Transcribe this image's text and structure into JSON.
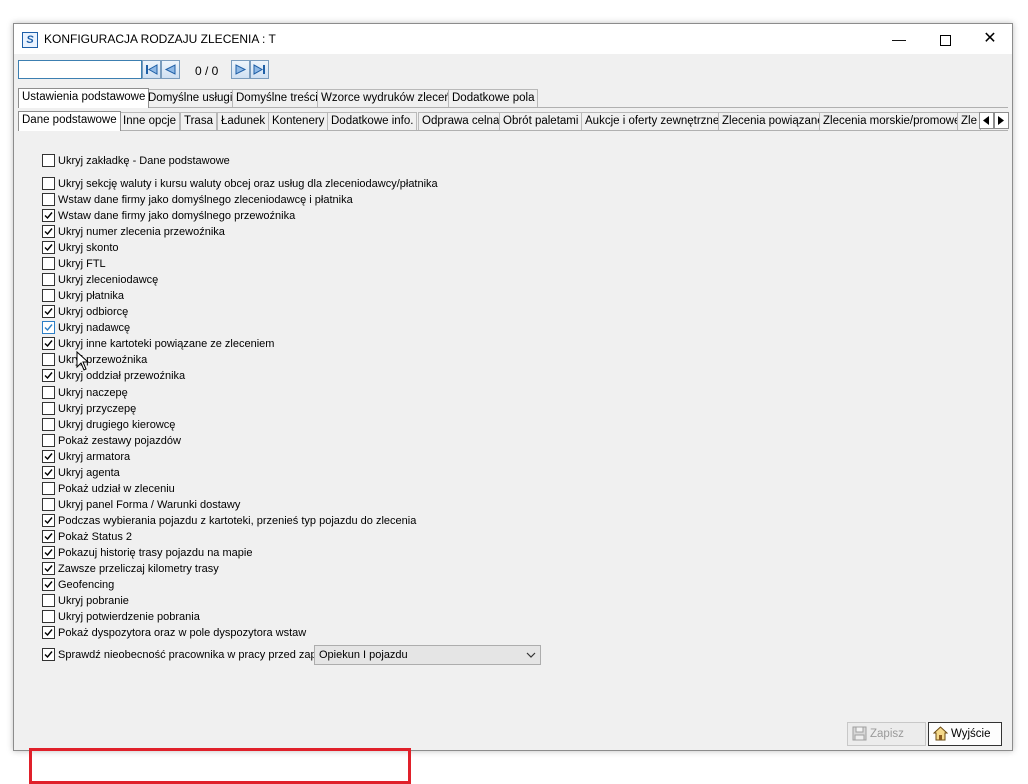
{
  "window": {
    "title": "KONFIGURACJA RODZAJU ZLECENIA : T",
    "app_icon": "S",
    "minimize": "—",
    "close": "✕"
  },
  "toolbar": {
    "search_value": "",
    "counter": "0 / 0"
  },
  "tabs_main": [
    {
      "label": "Ustawienia podstawowe",
      "active": true
    },
    {
      "label": "Domyślne usługi",
      "active": false
    },
    {
      "label": "Domyślne treści",
      "active": false
    },
    {
      "label": "Wzorce wydruków zleceń",
      "active": false
    },
    {
      "label": "Dodatkowe pola",
      "active": false
    }
  ],
  "tabs_sub": [
    {
      "label": "Dane podstawowe",
      "active": true
    },
    {
      "label": "Inne opcje",
      "active": false
    },
    {
      "label": "Trasa",
      "active": false
    },
    {
      "label": "Ładunek",
      "active": false
    },
    {
      "label": "Kontenery",
      "active": false
    },
    {
      "label": "Dodatkowe info.",
      "active": false
    },
    {
      "label": "Odprawa celna",
      "active": false
    },
    {
      "label": "Obrót paletami",
      "active": false
    },
    {
      "label": "Aukcje i oferty zewnętrzne",
      "active": false
    },
    {
      "label": "Zlecenia powiązane",
      "active": false
    },
    {
      "label": "Zlecenia morskie/promowe",
      "active": false
    },
    {
      "label": "Zle",
      "active": false
    }
  ],
  "options": [
    {
      "label": "Ukryj zakładkę - Dane podstawowe",
      "checked": false
    },
    {
      "label": "Ukryj sekcję waluty i kursu waluty obcej oraz usług dla zleceniodawcy/płatnika",
      "checked": false
    },
    {
      "label": "Wstaw dane firmy jako domyślnego zleceniodawcę i płatnika",
      "checked": false
    },
    {
      "label": "Wstaw dane firmy jako domyślnego przewoźnika",
      "checked": true
    },
    {
      "label": "Ukryj numer zlecenia przewoźnika",
      "checked": true
    },
    {
      "label": "Ukryj skonto",
      "checked": true
    },
    {
      "label": "Ukryj FTL",
      "checked": false
    },
    {
      "label": "Ukryj zleceniodawcę",
      "checked": false
    },
    {
      "label": "Ukryj płatnika",
      "checked": false
    },
    {
      "label": "Ukryj odbiorcę",
      "checked": true
    },
    {
      "label": "Ukryj nadawcę",
      "checked": true
    },
    {
      "label": "Ukryj inne kartoteki powiązane ze zleceniem",
      "checked": true
    },
    {
      "label": "Ukryj przewoźnika",
      "checked": false
    },
    {
      "label": "Ukryj oddział przewoźnika",
      "checked": true
    },
    {
      "label": "Ukryj naczepę",
      "checked": false
    },
    {
      "label": "Ukryj przyczepę",
      "checked": false
    },
    {
      "label": "Ukryj drugiego kierowcę",
      "checked": false
    },
    {
      "label": "Pokaż zestawy pojazdów",
      "checked": false
    },
    {
      "label": "Ukryj armatora",
      "checked": true
    },
    {
      "label": "Ukryj agenta",
      "checked": true
    },
    {
      "label": "Pokaż udział w zleceniu",
      "checked": false
    },
    {
      "label": "Ukryj panel Forma / Warunki dostawy",
      "checked": false
    },
    {
      "label": "Podczas wybierania pojazdu z kartoteki, przenieś typ pojazdu do zlecenia",
      "checked": true
    },
    {
      "label": "Pokaż Status 2",
      "checked": true
    },
    {
      "label": "Pokazuj historię trasy pojazdu na mapie",
      "checked": true
    },
    {
      "label": "Zawsze przeliczaj kilometry trasy",
      "checked": true
    },
    {
      "label": "Geofencing",
      "checked": true
    },
    {
      "label": "Ukryj pobranie",
      "checked": false
    },
    {
      "label": "Ukryj potwierdzenie pobrania",
      "checked": false
    },
    {
      "label": "Pokaż dyspozytora oraz w pole dyspozytora wstaw",
      "checked": true
    },
    {
      "label": "Sprawdź nieobecność pracownika w pracy przed zapisaniem zlecenia",
      "checked": true
    }
  ],
  "dispatcher_select": {
    "value": "Opiekun I pojazdu"
  },
  "buttons": {
    "save": "Zapisz",
    "exit": "Wyjście"
  }
}
